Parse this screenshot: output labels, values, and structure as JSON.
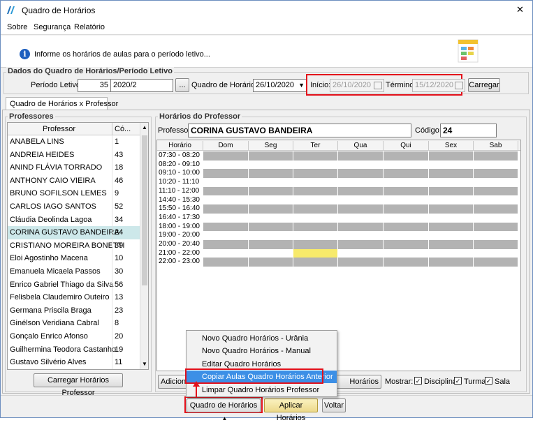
{
  "window": {
    "title": "Quadro de Horários",
    "close_glyph": "✕"
  },
  "menu": [
    "Sobre",
    "Segurança",
    "Relatório"
  ],
  "info": {
    "text": "Informe os horários de aulas para o período letivo..."
  },
  "dados": {
    "legend": "Dados do Quadro de Horários/Período Letivo",
    "periodo_label": "Período Letivo:",
    "periodo_code": "35",
    "periodo_value": "2020/2",
    "ellipsis": "...",
    "quadro_label": "Quadro de Horários:",
    "quadro_value": "26/10/2020",
    "inicio_label": "Início:",
    "inicio_value": "26/10/2020",
    "termino_label": "Término:",
    "termino_value": "15/12/2020",
    "carregar": "Carregar"
  },
  "tab": {
    "label": "Quadro de Horários x Professor"
  },
  "professores": {
    "legend": "Professores",
    "col_professor": "Professor",
    "col_codigo": "Có...",
    "selected_index": 7,
    "rows": [
      {
        "name": "ANABELA LINS",
        "code": "1"
      },
      {
        "name": "ANDREIA HEIDES",
        "code": "43"
      },
      {
        "name": "ANIND FLÁVIA TORRADO",
        "code": "18"
      },
      {
        "name": "ANTHONY CAIO VIEIRA",
        "code": "46"
      },
      {
        "name": "BRUNO SOFILSON LEMES",
        "code": "9"
      },
      {
        "name": "CARLOS IAGO SANTOS",
        "code": "52"
      },
      {
        "name": "Cláudia Deolinda Lagoa",
        "code": "34"
      },
      {
        "name": "CORINA GUSTAVO BANDEIRA",
        "code": "24"
      },
      {
        "name": "CRISTIANO MOREIRA BONETTI",
        "code": "39"
      },
      {
        "name": "Eloi Agostinho Macena",
        "code": "10"
      },
      {
        "name": "Emanuela Micaela Passos",
        "code": "30"
      },
      {
        "name": "Enrico Gabriel Thiago da Silva",
        "code": "56"
      },
      {
        "name": "Felisbela Claudemiro Outeiro",
        "code": "13"
      },
      {
        "name": "Germana Priscila Braga",
        "code": "23"
      },
      {
        "name": "Ginélson Veridiana Cabral",
        "code": "8"
      },
      {
        "name": "Gonçalo Enrico Afonso",
        "code": "20"
      },
      {
        "name": "Guilhermina Teodora Castanho",
        "code": "19"
      },
      {
        "name": "Gustavo Silvério Alves",
        "code": "11"
      }
    ],
    "carregar_btn": "Carregar Horários Professor"
  },
  "horarios": {
    "legend": "Horários do Professor",
    "prof_label": "Professor:",
    "prof_value": "CORINA GUSTAVO BANDEIRA",
    "codigo_label": "Código:",
    "codigo_value": "24",
    "columns": [
      "Horário",
      "Dom",
      "Seg",
      "Ter",
      "Qua",
      "Qui",
      "Sex",
      "Sab"
    ],
    "rows": [
      {
        "time": "07:30 - 08:20",
        "filled": true
      },
      {
        "time": "08:20 - 09:10",
        "filled": false
      },
      {
        "time": "09:10 - 10:00",
        "filled": true
      },
      {
        "time": "10:20 - 11:10",
        "filled": false
      },
      {
        "time": "11:10 - 12:00",
        "filled": true
      },
      {
        "time": "14:40 - 15:30",
        "filled": false
      },
      {
        "time": "15:50 - 16:40",
        "filled": true
      },
      {
        "time": "16:40 - 17:30",
        "filled": false
      },
      {
        "time": "18:00 - 19:00",
        "filled": true
      },
      {
        "time": "19:00 - 20:00",
        "filled": false
      },
      {
        "time": "20:00 - 20:40",
        "filled": true
      },
      {
        "time": "21:00 - 22:00",
        "filled": false
      },
      {
        "time": "22:00 - 23:00",
        "filled": true
      }
    ],
    "highlight": {
      "row": 11,
      "col": 3
    },
    "colors": {
      "filled": "#b3b3b3",
      "highlight": "#f7ea6b",
      "selected_row": "#cde8ea"
    }
  },
  "bottom": {
    "adicionar_partial": "Adicionar",
    "aplicados_partial": "Horários Aplicados",
    "mostrar_label": "Mostrar:",
    "chk_disciplina": "Disciplina",
    "chk_turma": "Turma",
    "chk_sala": "Sala"
  },
  "context_menu": {
    "items": [
      "Novo Quadro Horários - Urânia",
      "Novo Quadro Horários - Manual",
      "Editar Quadro Horários",
      "Copiar Aulas Quadro Horários Anterior",
      "Limpar Quadro Horários Professor"
    ],
    "highlighted_index": 3
  },
  "footer": {
    "quadro_btn": "Quadro de Horários",
    "aplicar_btn": "Aplicar Horários",
    "voltar_btn": "Voltar"
  }
}
